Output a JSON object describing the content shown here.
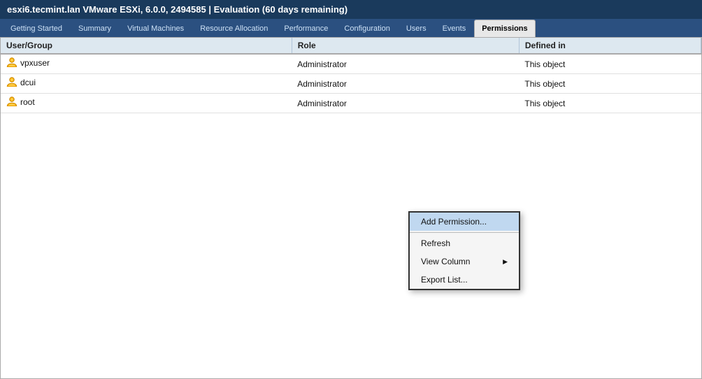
{
  "titleBar": {
    "text": "esxi6.tecmint.lan VMware ESXi, 6.0.0, 2494585 | Evaluation (60 days remaining)"
  },
  "tabs": [
    {
      "id": "getting-started",
      "label": "Getting Started",
      "active": false
    },
    {
      "id": "summary",
      "label": "Summary",
      "active": false
    },
    {
      "id": "virtual-machines",
      "label": "Virtual Machines",
      "active": false
    },
    {
      "id": "resource-allocation",
      "label": "Resource Allocation",
      "active": false
    },
    {
      "id": "performance",
      "label": "Performance",
      "active": false
    },
    {
      "id": "configuration",
      "label": "Configuration",
      "active": false
    },
    {
      "id": "users",
      "label": "Users",
      "active": false
    },
    {
      "id": "events",
      "label": "Events",
      "active": false
    },
    {
      "id": "permissions",
      "label": "Permissions",
      "active": true
    }
  ],
  "table": {
    "columns": [
      "User/Group",
      "Role",
      "Defined in"
    ],
    "rows": [
      {
        "user": "vpxuser",
        "role": "Administrator",
        "defined": "This object"
      },
      {
        "user": "dcui",
        "role": "Administrator",
        "defined": "This object"
      },
      {
        "user": "root",
        "role": "Administrator",
        "defined": "This object"
      }
    ]
  },
  "contextMenu": {
    "items": [
      {
        "id": "add-permission",
        "label": "Add Permission...",
        "highlighted": true,
        "hasArrow": false
      },
      {
        "id": "refresh",
        "label": "Refresh",
        "highlighted": false,
        "hasArrow": false
      },
      {
        "id": "view-column",
        "label": "View Column",
        "highlighted": false,
        "hasArrow": true
      },
      {
        "id": "export-list",
        "label": "Export List...",
        "highlighted": false,
        "hasArrow": false
      }
    ]
  }
}
